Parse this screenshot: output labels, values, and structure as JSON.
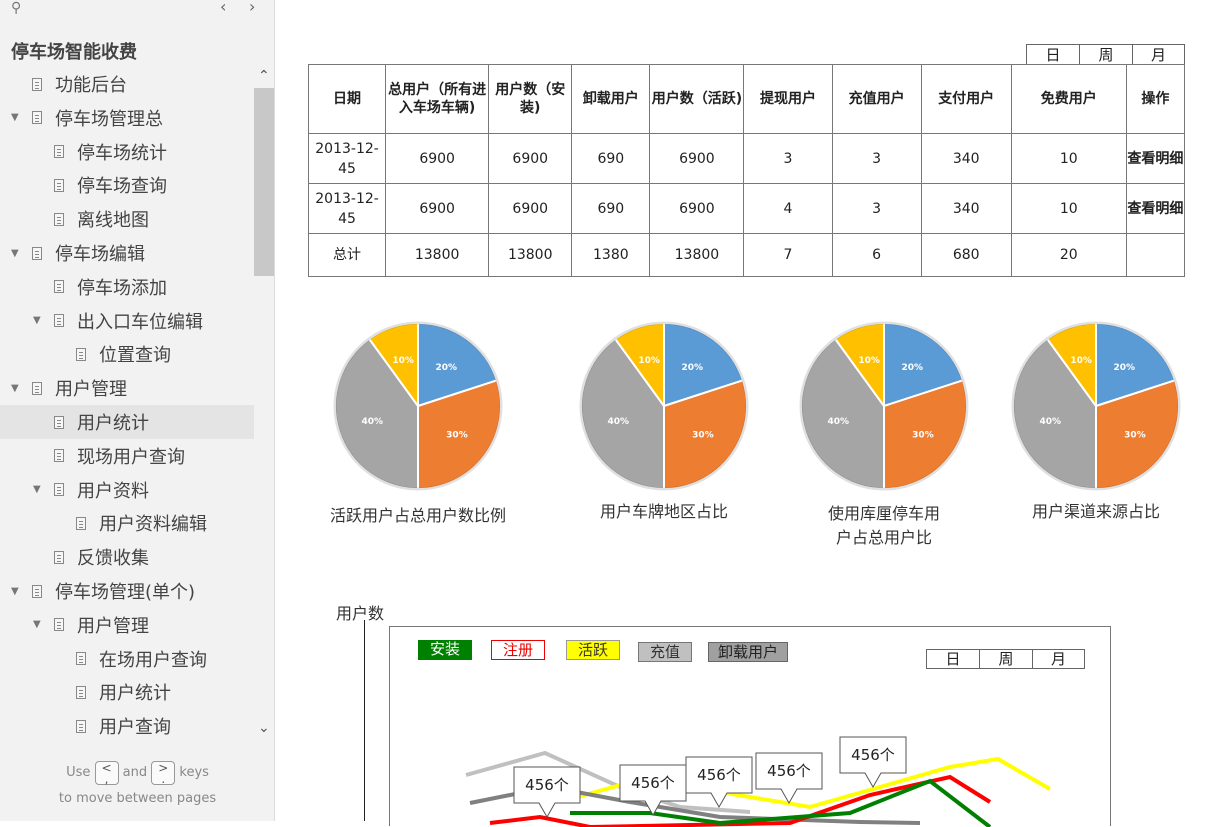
{
  "sidebar": {
    "project_title": "停车场智能收费",
    "items": [
      {
        "label": "功能后台",
        "level": 0,
        "caret": false
      },
      {
        "label": "停车场管理总",
        "level": 0,
        "caret": true
      },
      {
        "label": "停车场统计",
        "level": 1,
        "caret": false
      },
      {
        "label": "停车场查询",
        "level": 1,
        "caret": false
      },
      {
        "label": "离线地图",
        "level": 1,
        "caret": false
      },
      {
        "label": "停车场编辑",
        "level": 0,
        "caret": true
      },
      {
        "label": "停车场添加",
        "level": 1,
        "caret": false
      },
      {
        "label": "出入口车位编辑",
        "level": 1,
        "caret": true
      },
      {
        "label": "位置查询",
        "level": 2,
        "caret": false
      },
      {
        "label": "用户管理",
        "level": 0,
        "caret": true
      },
      {
        "label": "用户统计",
        "level": 1,
        "caret": false,
        "active": true
      },
      {
        "label": "现场用户查询",
        "level": 1,
        "caret": false
      },
      {
        "label": "用户资料",
        "level": 1,
        "caret": true
      },
      {
        "label": "用户资料编辑",
        "level": 2,
        "caret": false
      },
      {
        "label": "反馈收集",
        "level": 1,
        "caret": false
      },
      {
        "label": "停车场管理(单个)",
        "level": 0,
        "caret": true
      },
      {
        "label": "用户管理",
        "level": 1,
        "caret": true
      },
      {
        "label": "在场用户查询",
        "level": 2,
        "caret": false
      },
      {
        "label": "用户统计",
        "level": 2,
        "caret": false
      },
      {
        "label": "用户查询",
        "level": 2,
        "caret": false
      }
    ],
    "hint": {
      "use": "Use",
      "and": "and",
      "keys": "keys",
      "line2": "to move between pages",
      "key_prev": "<\n,",
      "key_next": ">\n."
    }
  },
  "period_tabs": [
    "日",
    "周",
    "月"
  ],
  "table": {
    "headers": [
      "日期",
      "总用户（所有进入车场车辆)",
      "用户数（安装)",
      "卸载用户",
      "用户数（活跃)",
      "提现用户",
      "充值用户",
      "支付用户",
      "免费用户",
      "操作"
    ],
    "rows": [
      [
        "2013-12-45",
        "6900",
        "6900",
        "690",
        "6900",
        "3",
        "3",
        "340",
        "10",
        "查看明细"
      ],
      [
        "2013-12-45",
        "6900",
        "6900",
        "690",
        "6900",
        "4",
        "3",
        "340",
        "10",
        "查看明细"
      ],
      [
        "总计",
        "13800",
        "13800",
        "1380",
        "13800",
        "7",
        "6",
        "680",
        "20",
        ""
      ]
    ]
  },
  "chart_data": [
    {
      "type": "pie",
      "title": "活跃用户占总用户数比例",
      "labels": [
        "20%",
        "30%",
        "40%",
        "10%"
      ],
      "values": [
        20,
        30,
        40,
        10
      ],
      "colors": [
        "#5b9bd5",
        "#ed7d31",
        "#a5a5a5",
        "#ffc000"
      ]
    },
    {
      "type": "pie",
      "title": "用户车牌地区占比",
      "labels": [
        "20%",
        "30%",
        "40%",
        "10%"
      ],
      "values": [
        20,
        30,
        40,
        10
      ],
      "colors": [
        "#5b9bd5",
        "#ed7d31",
        "#a5a5a5",
        "#ffc000"
      ]
    },
    {
      "type": "pie",
      "title": "使用库厘停车用户占总用户比",
      "labels": [
        "20%",
        "30%",
        "40%",
        "10%"
      ],
      "values": [
        20,
        30,
        40,
        10
      ],
      "colors": [
        "#5b9bd5",
        "#ed7d31",
        "#a5a5a5",
        "#ffc000"
      ]
    },
    {
      "type": "pie",
      "title": "用户渠道来源占比",
      "labels": [
        "20%",
        "30%",
        "40%",
        "10%"
      ],
      "values": [
        20,
        30,
        40,
        10
      ],
      "colors": [
        "#5b9bd5",
        "#ed7d31",
        "#a5a5a5",
        "#ffc000"
      ]
    },
    {
      "type": "line",
      "ylabel": "用户数",
      "legend": [
        {
          "name": "安装",
          "color": "#008000"
        },
        {
          "name": "注册",
          "color": "#ff0000"
        },
        {
          "name": "活跃",
          "color": "#ffff00"
        },
        {
          "name": "充值",
          "color": "#c0c0c0"
        },
        {
          "name": "卸载用户",
          "color": "#808080"
        }
      ],
      "callouts": [
        "456个",
        "456个",
        "456个",
        "456个",
        "456个"
      ]
    }
  ],
  "pie_captions": [
    [
      "活跃用户占总用户数比例"
    ],
    [
      "用户车牌地区占比"
    ],
    [
      "使用库厘停车用",
      "户占总用户比"
    ],
    [
      "用户渠道来源占比"
    ]
  ]
}
